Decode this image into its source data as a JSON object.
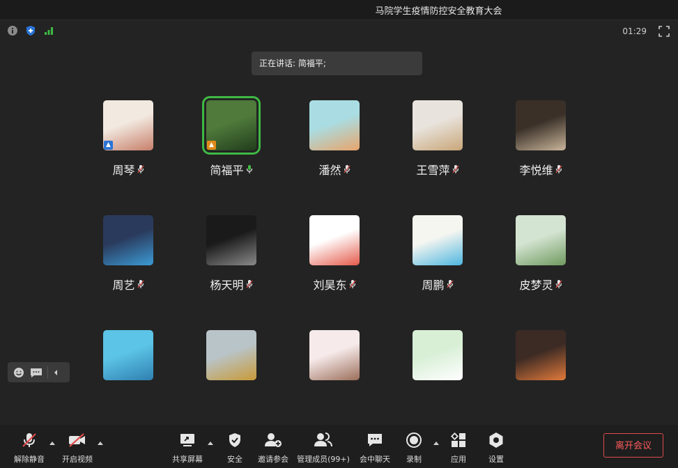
{
  "window": {
    "title": "马院学生疫情防控安全教育大会"
  },
  "top": {
    "timer": "01:29"
  },
  "speaking": {
    "text": "正在讲话: 简福平;"
  },
  "participants": [
    {
      "name": "周琴",
      "colors": [
        "#f2e9e0",
        "#c77f6a"
      ],
      "badge": "#2a74d6",
      "active": false,
      "mic_on": false
    },
    {
      "name": "简福平",
      "colors": [
        "#4f7a3b",
        "#213d1c"
      ],
      "badge": "#e08a1a",
      "active": true,
      "mic_on": true
    },
    {
      "name": "潘然",
      "colors": [
        "#a9dde3",
        "#e8a56b"
      ],
      "badge": "",
      "active": false,
      "mic_on": false
    },
    {
      "name": "王雪萍",
      "colors": [
        "#e8e3dc",
        "#c9a679"
      ],
      "badge": "",
      "active": false,
      "mic_on": false
    },
    {
      "name": "李悦维",
      "colors": [
        "#3a3028",
        "#c9b59a"
      ],
      "badge": "",
      "active": false,
      "mic_on": false
    },
    {
      "name": "周艺",
      "colors": [
        "#2a3a5c",
        "#3c9bd6"
      ],
      "badge": "",
      "active": false,
      "mic_on": false
    },
    {
      "name": "杨天明",
      "colors": [
        "#1a1a1a",
        "#8a8a8a"
      ],
      "badge": "",
      "active": false,
      "mic_on": false
    },
    {
      "name": "刘昊东",
      "colors": [
        "#ffffff",
        "#e45a4a"
      ],
      "badge": "",
      "active": false,
      "mic_on": false
    },
    {
      "name": "周鹏",
      "colors": [
        "#f6f6f0",
        "#4eb6e0"
      ],
      "badge": "",
      "active": false,
      "mic_on": false
    },
    {
      "name": "皮梦灵",
      "colors": [
        "#d4e4d2",
        "#6f9a5f"
      ],
      "badge": "",
      "active": false,
      "mic_on": false
    },
    {
      "name": "",
      "colors": [
        "#5cc4e6",
        "#2f7fb0"
      ],
      "badge": "",
      "active": false,
      "mic_on": false
    },
    {
      "name": "",
      "colors": [
        "#b9c4c8",
        "#c89a38"
      ],
      "badge": "",
      "active": false,
      "mic_on": false
    },
    {
      "name": "",
      "colors": [
        "#f6eaea",
        "#9b6e5a"
      ],
      "badge": "",
      "active": false,
      "mic_on": false
    },
    {
      "name": "",
      "colors": [
        "#d8efd6",
        "#ffffff"
      ],
      "badge": "",
      "active": false,
      "mic_on": false
    },
    {
      "name": "",
      "colors": [
        "#3c2a24",
        "#e27a3b"
      ],
      "badge": "",
      "active": false,
      "mic_on": false
    }
  ],
  "toolbar": {
    "unmute": "解除静音",
    "start_video": "开启视频",
    "share_screen": "共享屏幕",
    "security": "安全",
    "invite": "邀请参会",
    "manage": "管理成员(99+)",
    "chat": "会中聊天",
    "record": "录制",
    "apps": "应用",
    "settings": "设置",
    "leave": "离开会议"
  },
  "icons": {
    "info": "info-icon",
    "shield": "shield-icon",
    "signal": "signal-icon",
    "fullscreen": "fullscreen-icon",
    "emoji": "emoji-icon",
    "chat_bubble": "chat-bubble-icon",
    "collapse": "collapse-arrow-icon"
  },
  "colors": {
    "active_speaker": "#3fb944",
    "leave": "#e04b4b",
    "background": "#232323"
  }
}
